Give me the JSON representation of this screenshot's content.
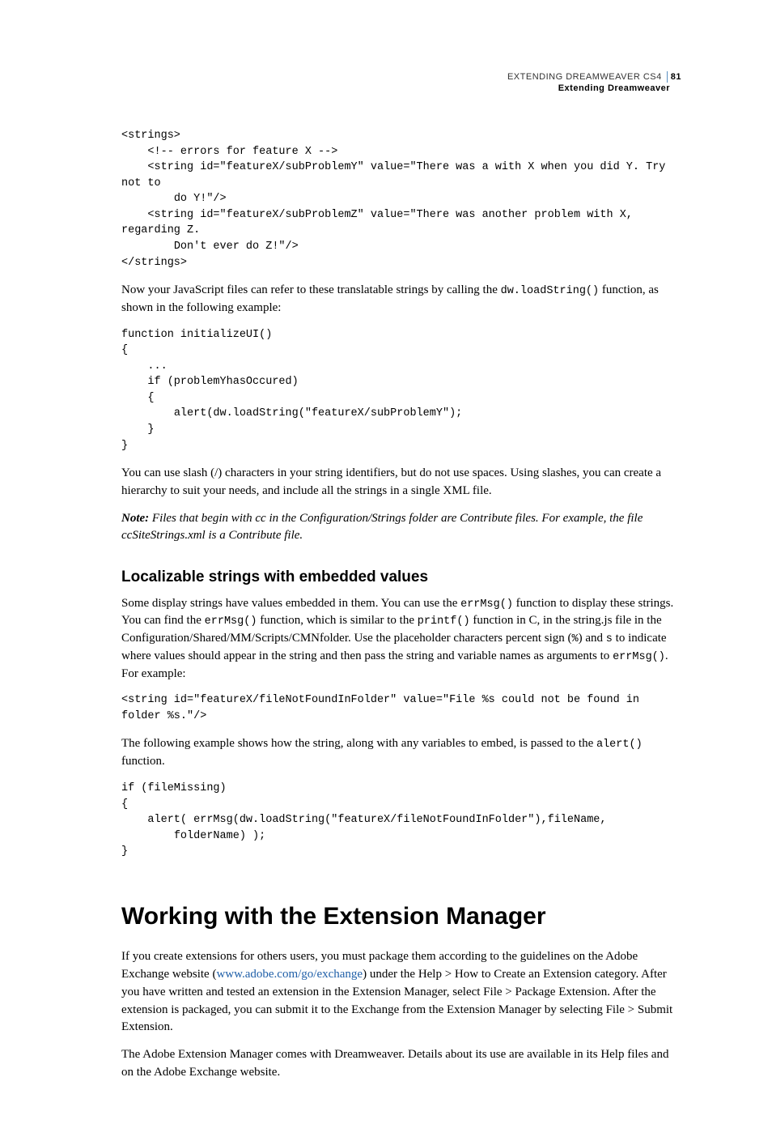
{
  "header": {
    "title": "EXTENDING DREAMWEAVER CS4",
    "subtitle": "Extending Dreamweaver",
    "page_number": "81"
  },
  "code1": "<strings>\n    <!-- errors for feature X -->\n    <string id=\"featureX/subProblemY\" value=\"There was a with X when you did Y. Try not to \n        do Y!\"/>\n    <string id=\"featureX/subProblemZ\" value=\"There was another problem with X, regarding Z. \n        Don't ever do Z!\"/>\n</strings>",
  "para1_a": "Now your JavaScript files can refer to these translatable strings by calling the ",
  "para1_code": "dw.loadString()",
  "para1_b": " function, as shown in the following example:",
  "code2": "function initializeUI()\n{\n    ...\n    if (problemYhasOccured)\n    {\n        alert(dw.loadString(\"featureX/subProblemY\");\n    }\n}",
  "para2": "You can use slash (/) characters in your string identifiers, but do not use spaces. Using slashes, you can create a hierarchy to suit your needs, and include all the strings in a single XML file.",
  "note_label": "Note:",
  "note_body": " Files that begin with cc in the Configuration/Strings folder are Contribute files. For example, the file ccSiteStrings.xml is a Contribute file.",
  "section_heading": "Localizable strings with embedded values",
  "para3_a": "Some display strings have values embedded in them. You can use the ",
  "para3_c1": "errMsg()",
  "para3_b": " function to display these strings. You can find the ",
  "para3_c2": "errMsg()",
  "para3_c": " function, which is similar to the ",
  "para3_c3": "printf()",
  "para3_d": " function in C, in the string.js file in the Configuration/Shared/MM/Scripts/CMNfolder. Use the placeholder characters percent sign (",
  "para3_c4": "%",
  "para3_e": ") and ",
  "para3_c5": "s",
  "para3_f": " to indicate where values should appear in the string and then pass the string and variable names as arguments to ",
  "para3_c6": "errMsg()",
  "para3_g": ". For example:",
  "code3": "<string id=\"featureX/fileNotFoundInFolder\" value=\"File %s could not be found in folder %s.\"/>",
  "para4_a": "The following example shows how the string, along with any variables to embed, is passed to the ",
  "para4_c1": "alert()",
  "para4_b": " function.",
  "code4": "if (fileMissing)\n{\n    alert( errMsg(dw.loadString(\"featureX/fileNotFoundInFolder\"),fileName, \n        folderName) );\n}",
  "chapter_heading": "Working with the Extension Manager",
  "para5_a": "If you create extensions for others users, you must package them according to the guidelines on the Adobe Exchange website (",
  "para5_link": "www.adobe.com/go/exchange",
  "para5_b": ") under the Help > How to Create an Extension category. After you have written and tested an extension in the Extension Manager, select File > Package Extension. After the extension is packaged, you can submit it to the Exchange from the Extension Manager by selecting File > Submit Extension.",
  "para6": "The Adobe Extension Manager comes with Dreamweaver. Details about its use are available in its Help files and on the Adobe Exchange website."
}
